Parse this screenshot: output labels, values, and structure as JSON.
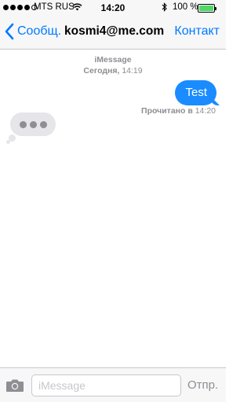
{
  "status_bar": {
    "carrier": "MTS RUS",
    "time": "14:20",
    "bluetooth_icon": "bluetooth-icon",
    "battery_percent": "100 %",
    "battery_color": "#4cd964",
    "signal_bars_filled": 4,
    "signal_bars_total": 5
  },
  "nav": {
    "back_label": "Сообщ.",
    "title": "kosmi4@me.com",
    "contact_label": "Контакт",
    "accent_color": "#007aff"
  },
  "thread": {
    "service": "iMessage",
    "day": "Сегодня,",
    "time": "14:19"
  },
  "messages": [
    {
      "direction": "outgoing",
      "text": "Test",
      "color": "#1a8cff"
    }
  ],
  "read_receipt": {
    "label": "Прочитано в",
    "time": "14:20"
  },
  "typing_indicator": {
    "visible": true
  },
  "input_bar": {
    "placeholder": "iMessage",
    "value": "",
    "send_label": "Отпр.",
    "camera_icon": "camera-icon"
  }
}
